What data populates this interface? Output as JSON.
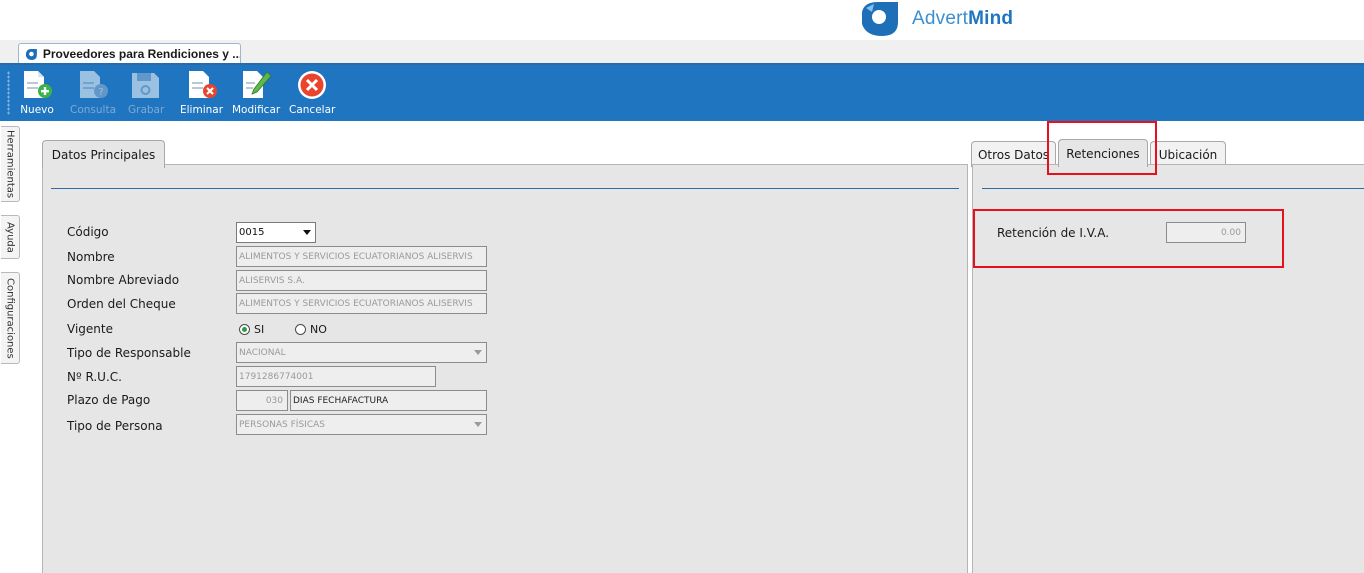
{
  "brand": {
    "name_regular": "Advert",
    "name_bold": "Mind"
  },
  "document_tab": {
    "label": "Proveedores para Rendiciones y ..."
  },
  "toolbar": {
    "buttons": [
      {
        "label": "Nuevo",
        "enabled": true
      },
      {
        "label": "Consulta",
        "enabled": false
      },
      {
        "label": "Grabar",
        "enabled": false
      },
      {
        "label": "Eliminar",
        "enabled": true
      },
      {
        "label": "Modificar",
        "enabled": true
      },
      {
        "label": "Cancelar",
        "enabled": true
      }
    ]
  },
  "side_tabs": [
    "Herramientas",
    "Ayuda",
    "Configuraciones"
  ],
  "left_panel": {
    "tab": "Datos Principales",
    "fields": {
      "codigo": {
        "label": "Código",
        "value": "0015"
      },
      "nombre": {
        "label": "Nombre",
        "value": "ALIMENTOS Y SERVICIOS ECUATORIANOS ALISERVIS"
      },
      "nombre_abreviado": {
        "label": "Nombre Abreviado",
        "value": "ALISERVIS S.A."
      },
      "orden_cheque": {
        "label": "Orden del Cheque",
        "value": "ALIMENTOS Y SERVICIOS ECUATORIANOS ALISERVIS"
      },
      "vigente": {
        "label": "Vigente",
        "option_si": "SI",
        "option_no": "NO",
        "selected": "SI"
      },
      "tipo_responsable": {
        "label": "Tipo de Responsable",
        "value": "NACIONAL"
      },
      "ruc": {
        "label": "Nº  R.U.C.",
        "value": "1791286774001"
      },
      "plazo_pago": {
        "label": "Plazo de Pago",
        "days": "030",
        "description": "DIAS FECHAFACTURA"
      },
      "tipo_persona": {
        "label": "Tipo de Persona",
        "value": "PERSONAS FÍSICAS"
      }
    }
  },
  "right_panel": {
    "tabs": [
      "Otros Datos",
      "Retenciones",
      "Ubicación"
    ],
    "active_tab": "Retenciones",
    "retencion_iva": {
      "label": "Retención de I.V.A.",
      "value": "0.00"
    }
  },
  "colors": {
    "toolbar": "#1f75c0",
    "highlight": "#e8101c",
    "accent": "#3a8fd0"
  }
}
